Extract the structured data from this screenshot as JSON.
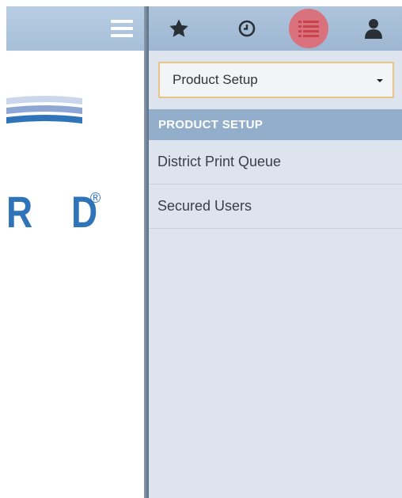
{
  "left": {
    "logo_text": "R D",
    "logo_reg": "®",
    "colors": {
      "logo": "#2f73b8",
      "header": "#a6bfd9"
    }
  },
  "toolbar": {
    "buttons": [
      {
        "icon": "star-icon"
      },
      {
        "icon": "clock-icon"
      },
      {
        "icon": "list-icon",
        "active": true
      },
      {
        "icon": "user-icon"
      }
    ],
    "active_color": "#d9727d"
  },
  "product_select": {
    "value": "Product Setup"
  },
  "section": {
    "title": "PRODUCT SETUP"
  },
  "menu": {
    "items": [
      {
        "label": "District Print Queue"
      },
      {
        "label": "Secured Users"
      }
    ]
  }
}
